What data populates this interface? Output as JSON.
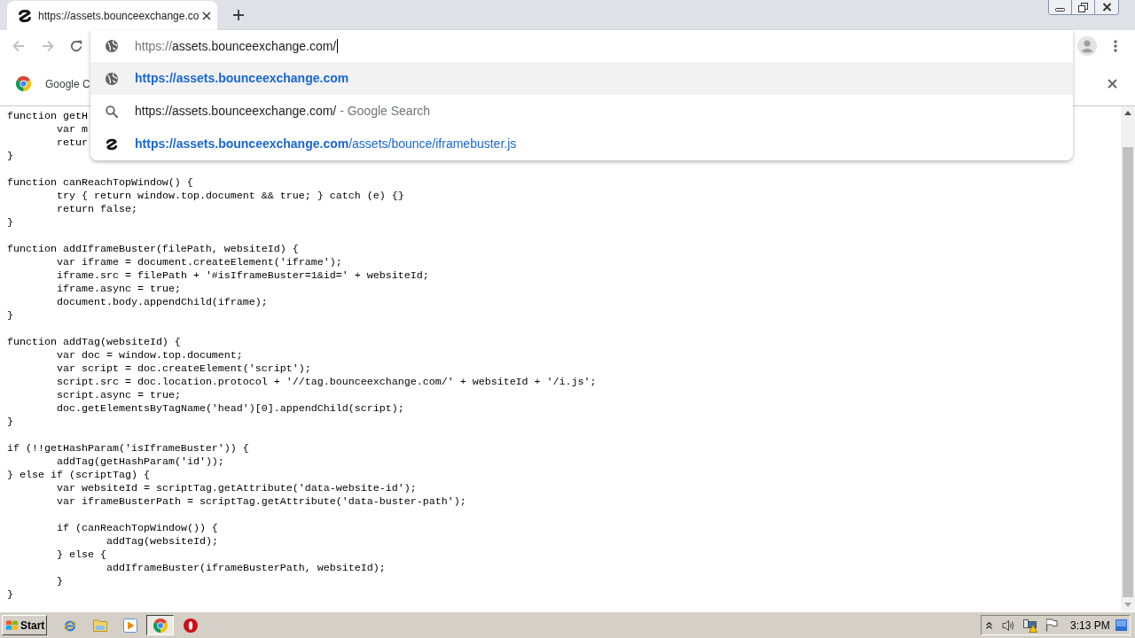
{
  "tab": {
    "title": "https://assets.bounceexchange.co",
    "selected": true
  },
  "omnibox": {
    "scheme": "https://",
    "rest": "assets.bounceexchange.com/"
  },
  "suggestions": [
    {
      "kind": "history",
      "match": "https://assets.bounceexchange.com",
      "selected": true
    },
    {
      "kind": "search",
      "match": "https://assets.bounceexchange.com/",
      "suffix": "- Google Search",
      "selected": false
    },
    {
      "kind": "site",
      "match": "https://assets.bounceexchange.com",
      "rest": "/assets/bounce/iframebuster.js",
      "selected": false
    }
  ],
  "infobar": {
    "text": "Google C"
  },
  "code": {
    "blocks": [
      [
        "function getH",
        "\tvar m",
        "\tretur",
        "}"
      ],
      [
        "function canReachTopWindow() {",
        "\ttry { return window.top.document && true; } catch (e) {}",
        "\treturn false;",
        "}"
      ],
      [
        "function addIframeBuster(filePath, websiteId) {",
        "\tvar iframe = document.createElement('iframe');",
        "\tiframe.src = filePath + '#isIframeBuster=1&id=' + websiteId;",
        "\tiframe.async = true;",
        "\tdocument.body.appendChild(iframe);",
        "}"
      ],
      [
        "function addTag(websiteId) {",
        "\tvar doc = window.top.document;",
        "\tvar script = doc.createElement('script');",
        "\tscript.src = doc.location.protocol + '//tag.bounceexchange.com/' + websiteId + '/i.js';",
        "\tscript.async = true;",
        "\tdoc.getElementsByTagName('head')[0].appendChild(script);",
        "}"
      ],
      [
        "if (!!getHashParam('isIframeBuster')) {",
        "\taddTag(getHashParam('id'));",
        "} else if (scriptTag) {",
        "\tvar websiteId = scriptTag.getAttribute('data-website-id');",
        "\tvar iframeBusterPath = scriptTag.getAttribute('data-buster-path');"
      ],
      [
        "\tif (canReachTopWindow()) {",
        "\t\taddTag(websiteId);",
        "\t} else {",
        "\t\taddIframeBuster(iframeBusterPath, websiteId);",
        "\t}",
        "}"
      ]
    ]
  },
  "taskbar": {
    "start": "Start",
    "apps": [
      {
        "kind": "browser",
        "selected": false
      },
      {
        "kind": "folder",
        "selected": false
      },
      {
        "kind": "media",
        "selected": false
      },
      {
        "kind": "chrome",
        "selected": true
      },
      {
        "kind": "stop",
        "selected": false
      }
    ],
    "clock": "3:13 PM"
  }
}
